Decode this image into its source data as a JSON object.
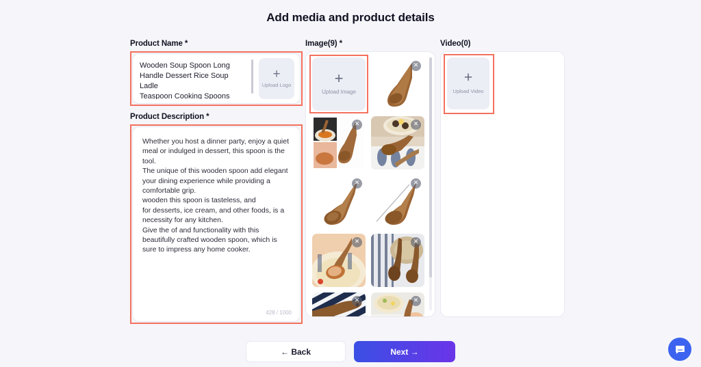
{
  "page": {
    "title": "Add media and product details"
  },
  "product_name": {
    "label": "Product Name *",
    "value": "Wooden Soup Spoon Long\nHandle Dessert Rice Soup Ladle\nTeaspoon Cooking Spoons\nKitchen Cutlery Gadget",
    "upload_logo": {
      "plus": "+",
      "caption": "Upload Logo"
    }
  },
  "product_description": {
    "label": "Product Description *",
    "value": "Whether you host a dinner party, enjoy a quiet meal or indulged in dessert, this spoon is the tool.\nThe unique of this wooden spoon add elegant your dining experience while providing a comfortable grip.\nwooden this spoon is tasteless, and\nfor desserts, ice cream, and other foods, is a necessity for any kitchen.\nGive the of and functionality with this beautifully crafted wooden spoon, which is sure to impress any home cooker.",
    "char_count": "428 / 1000"
  },
  "images": {
    "label": "Image(9) *",
    "upload": {
      "plus": "+",
      "caption": "Upload Image"
    },
    "delete_glyph": "✕",
    "thumbs": [
      {
        "name": "wooden-ladle-white-bg",
        "alt": "Wooden soup ladle on white background"
      },
      {
        "name": "ladle-collage-serving",
        "alt": "Collage of hands serving food with ladle"
      },
      {
        "name": "ladle-with-bowl-table",
        "alt": "Ladle beside bowl of food on table"
      },
      {
        "name": "ladle-side-view-white",
        "alt": "Wooden ladle side view on white"
      },
      {
        "name": "ladle-with-measurement",
        "alt": "Ladle with measurement annotation"
      },
      {
        "name": "ladle-in-soup-bowl",
        "alt": "Ladle scooping soup from bowl"
      },
      {
        "name": "two-ladles-striped-cloth",
        "alt": "Two wooden ladles on striped cloth"
      },
      {
        "name": "spoons-on-navy-cloth",
        "alt": "Wooden spoons on navy striped cloth"
      },
      {
        "name": "hand-holding-spoon-meal",
        "alt": "Hand holding wooden spoon over meal"
      }
    ]
  },
  "video": {
    "label": "Video(0)",
    "upload": {
      "plus": "+",
      "caption": "Upload Video"
    }
  },
  "footer": {
    "back_label": "←  Back",
    "next_label": "Next  →"
  },
  "chat": {
    "name": "chat-launcher"
  },
  "colors": {
    "background": "#f5f5fa",
    "annotation": "#f4705e",
    "next_gradient_start": "#3b4fe4",
    "next_gradient_end": "#6a35e8",
    "chat_blue": "#3b63f0"
  }
}
